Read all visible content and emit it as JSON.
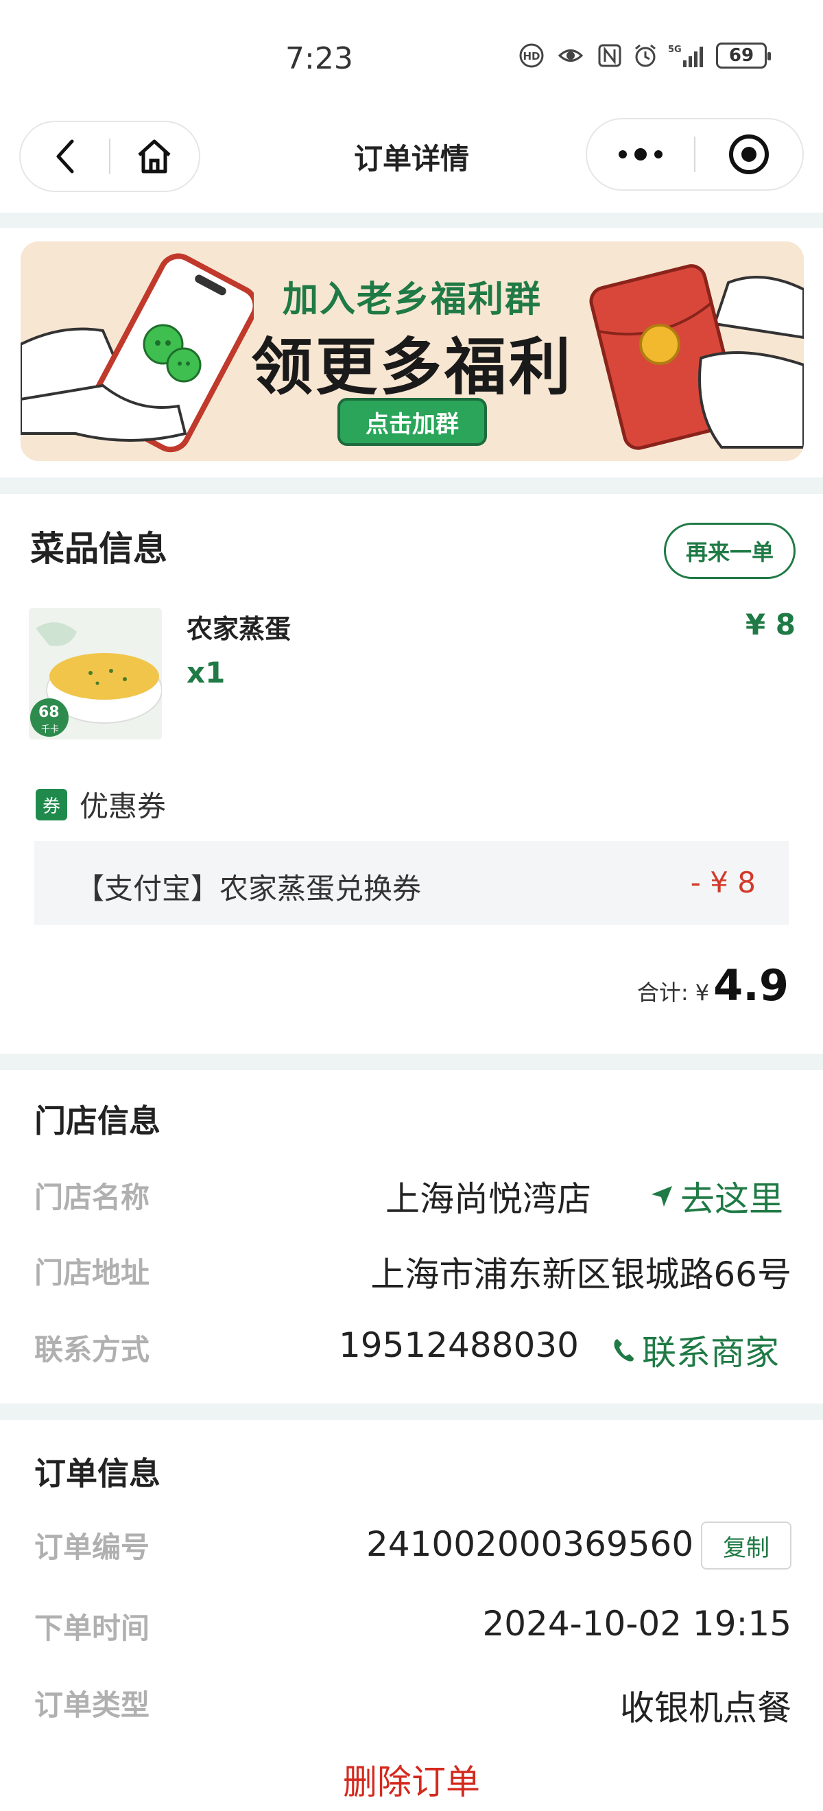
{
  "status_bar": {
    "time": "7:23",
    "battery": "69",
    "icons": [
      "hd-icon",
      "eye-icon",
      "nfc-icon",
      "alarm-icon",
      "signal-5g-icon",
      "battery-icon"
    ]
  },
  "nav": {
    "title": "订单详情",
    "back_icon": "chevron-left-icon",
    "home_icon": "home-icon",
    "more_icon": "more-dots-icon",
    "close_icon": "target-icon"
  },
  "banner": {
    "line1": "加入老乡福利群",
    "line2": "领更多福利",
    "button": "点击加群"
  },
  "dishes": {
    "title": "菜品信息",
    "reorder_label": "再来一单",
    "item": {
      "name": "农家蒸蛋",
      "qty": "x1",
      "price": "¥ 8",
      "calories": "68",
      "calories_unit": "千卡"
    },
    "coupon": {
      "tag": "券",
      "label": "优惠券",
      "name": "【支付宝】农家蒸蛋兑换券",
      "amount": "- ¥ 8"
    },
    "total": {
      "label": "合计: ¥",
      "value": "4.9"
    }
  },
  "store": {
    "title": "门店信息",
    "name_label": "门店名称",
    "name_value": "上海尚悦湾店",
    "navigate_label": "去这里",
    "address_label": "门店地址",
    "address_value": "上海市浦东新区银城路66号",
    "contact_label": "联系方式",
    "contact_value": "19512488030",
    "contact_action": "联系商家"
  },
  "order": {
    "title": "订单信息",
    "number_label": "订单编号",
    "number_value": "241002000369560",
    "copy_label": "复制",
    "time_label": "下单时间",
    "time_value": "2024-10-02 19:15",
    "type_label": "订单类型",
    "type_value": "收银机点餐",
    "delete_label": "删除订单"
  },
  "colors": {
    "brand_green": "#1f7a45",
    "danger_red": "#d42a1e",
    "section_gap": "#eef3f3"
  }
}
